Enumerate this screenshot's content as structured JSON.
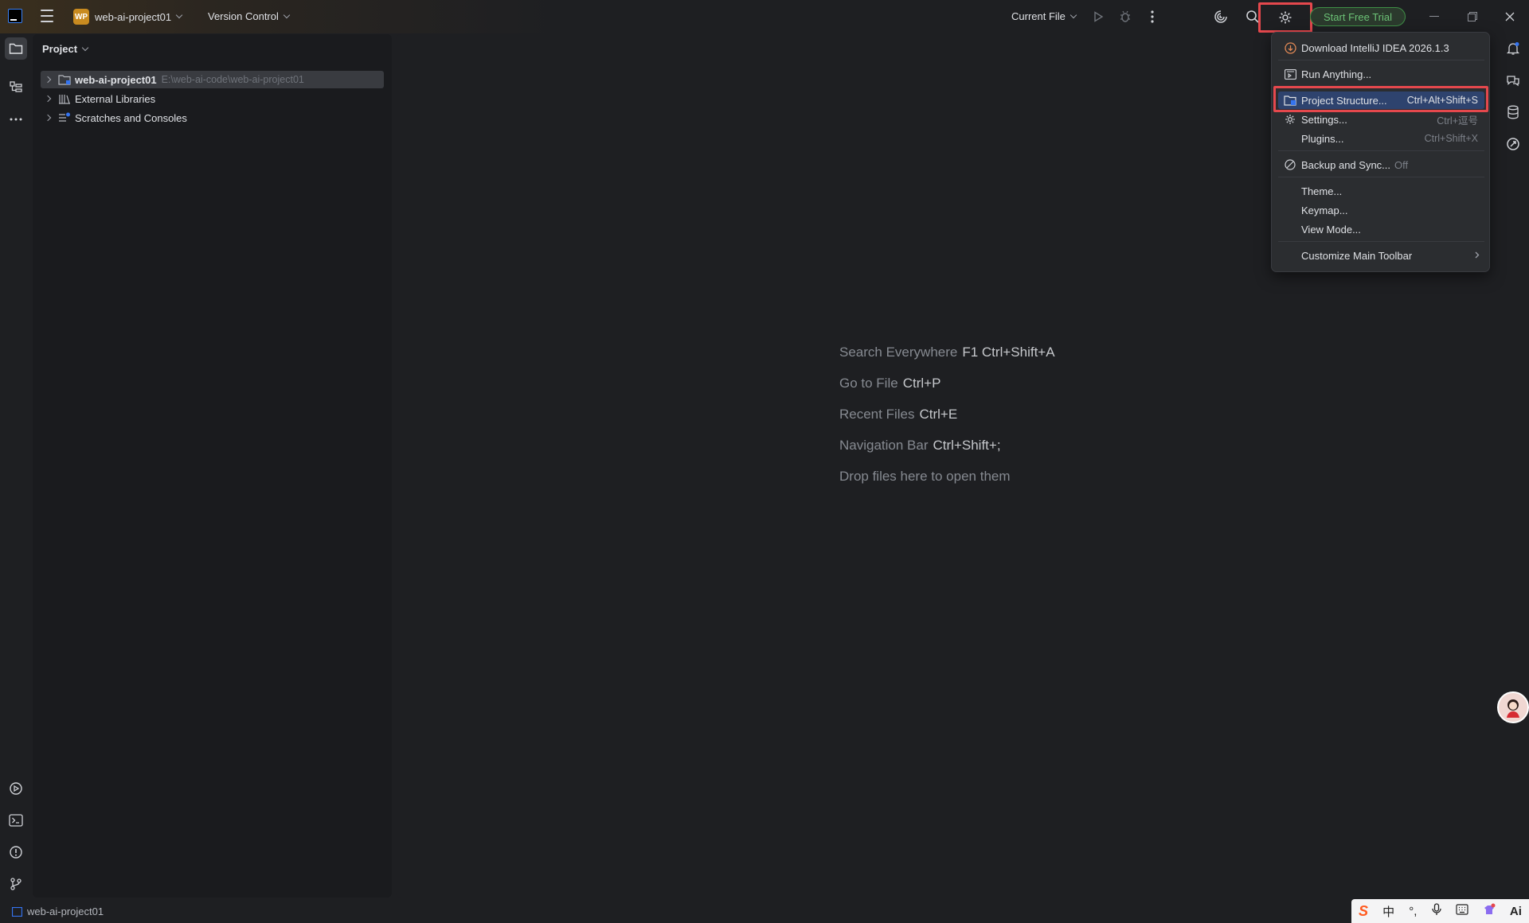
{
  "titlebar": {
    "project_badge": "WP",
    "project_name": "web-ai-project01",
    "vcs_label": "Version Control",
    "run_config": "Current File",
    "trial_button": "Start Free Trial"
  },
  "project_panel": {
    "title": "Project",
    "tree": [
      {
        "label": "web-ai-project01",
        "path": "E:\\web-ai-code\\web-ai-project01",
        "icon": "module-folder-icon",
        "selected": true
      },
      {
        "label": "External Libraries",
        "path": "",
        "icon": "library-icon",
        "selected": false
      },
      {
        "label": "Scratches and Consoles",
        "path": "",
        "icon": "scratches-icon",
        "selected": false
      }
    ]
  },
  "editor_hints": [
    {
      "label": "Search Everywhere",
      "shortcut": "F1 Ctrl+Shift+A"
    },
    {
      "label": "Go to File",
      "shortcut": "Ctrl+P"
    },
    {
      "label": "Recent Files",
      "shortcut": "Ctrl+E"
    },
    {
      "label": "Navigation Bar",
      "shortcut": "Ctrl+Shift+;"
    },
    {
      "label": "Drop files here to open them",
      "shortcut": ""
    }
  ],
  "settings_menu": {
    "items": [
      {
        "label": "Download IntelliJ IDEA 2026.1.3",
        "shortcut": "",
        "icon": "download-icon"
      },
      {
        "label": "Run Anything...",
        "shortcut": "",
        "icon": "run-anything-icon"
      },
      {
        "label": "Project Structure...",
        "shortcut": "Ctrl+Alt+Shift+S",
        "icon": "project-structure-icon",
        "highlighted": true
      },
      {
        "label": "Settings...",
        "shortcut": "Ctrl+逗号",
        "icon": "gear-icon"
      },
      {
        "label": "Plugins...",
        "shortcut": "Ctrl+Shift+X",
        "icon": ""
      },
      {
        "label": "Backup and Sync...",
        "suffix": "Off",
        "icon": "no-sync-icon"
      },
      {
        "label": "Theme...",
        "shortcut": ""
      },
      {
        "label": "Keymap...",
        "shortcut": ""
      },
      {
        "label": "View Mode...",
        "shortcut": ""
      },
      {
        "label": "Customize Main Toolbar",
        "shortcut": ""
      }
    ]
  },
  "statusbar": {
    "project": "web-ai-project01"
  },
  "ime": {
    "chinese": "中",
    "punct": "°,",
    "ai": "Ai"
  },
  "colors": {
    "accent": "#2e436e",
    "highlight_frame": "#e5484d",
    "trial_green": "#6cc276"
  }
}
